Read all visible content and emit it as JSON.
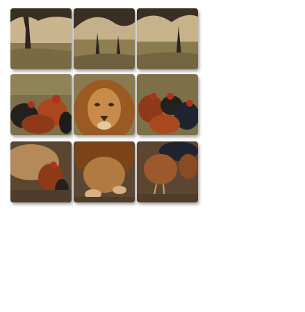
{
  "artwork": {
    "subject": "lion-among-roosters-savanna",
    "tile_rows": 3,
    "tile_cols": 3,
    "tiles": [
      {
        "region": "top-left",
        "content": "acacia-trees-sky"
      },
      {
        "region": "top-center",
        "content": "acacia-trees-grass"
      },
      {
        "region": "top-right",
        "content": "acacia-trees-grass"
      },
      {
        "region": "middle-left",
        "content": "roosters-grass"
      },
      {
        "region": "middle-center",
        "content": "lion-head-mane"
      },
      {
        "region": "middle-right",
        "content": "roosters-hens"
      },
      {
        "region": "bottom-left",
        "content": "lion-body-rooster"
      },
      {
        "region": "bottom-center",
        "content": "lion-mane-paws"
      },
      {
        "region": "bottom-right",
        "content": "hens-ground"
      }
    ],
    "colors": {
      "sky": "#c9b58e",
      "tree": "#3a2f24",
      "grass": "#8a7a4f",
      "mane": "#9a5a22",
      "fur": "#c88b4a",
      "rooster_red": "#b0301e",
      "rooster_dark": "#23211d",
      "soil": "#5b4631",
      "background": "#ffffff"
    }
  }
}
